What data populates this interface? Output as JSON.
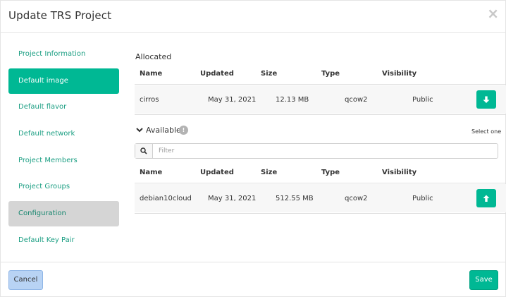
{
  "header": {
    "title": "Update TRS Project",
    "close_label": "×"
  },
  "sidebar": {
    "items": [
      {
        "label": "Project Information",
        "state": "default"
      },
      {
        "label": "Default image",
        "state": "active"
      },
      {
        "label": "Default flavor",
        "state": "default"
      },
      {
        "label": "Default network",
        "state": "default"
      },
      {
        "label": "Project Members",
        "state": "default"
      },
      {
        "label": "Project Groups",
        "state": "default"
      },
      {
        "label": "Configuration",
        "state": "muted"
      },
      {
        "label": "Default Key Pair",
        "state": "default"
      }
    ]
  },
  "allocated": {
    "label": "Allocated",
    "columns": [
      "Name",
      "Updated",
      "Size",
      "Type",
      "Visibility"
    ],
    "rows": [
      {
        "name": "cirros",
        "updated": "May 31, 2021",
        "size": "12.13 MB",
        "type": "qcow2",
        "visibility": "Public",
        "action_icon": "arrow-down-icon"
      }
    ]
  },
  "available": {
    "label": "Available",
    "info_badge": "!",
    "select_hint": "Select one",
    "filter_placeholder": "Filter",
    "filter_value": "",
    "columns": [
      "Name",
      "Updated",
      "Size",
      "Type",
      "Visibility"
    ],
    "rows": [
      {
        "name": "debian10cloud",
        "updated": "May 31, 2021",
        "size": "512.55 MB",
        "type": "qcow2",
        "visibility": "Public",
        "action_icon": "arrow-up-icon"
      }
    ]
  },
  "footer": {
    "cancel_label": "Cancel",
    "save_label": "Save"
  },
  "colors": {
    "accent": "#00b894",
    "link": "#1a9e82",
    "cancel": "#b8d3f4",
    "muted": "#d5d5d5"
  }
}
